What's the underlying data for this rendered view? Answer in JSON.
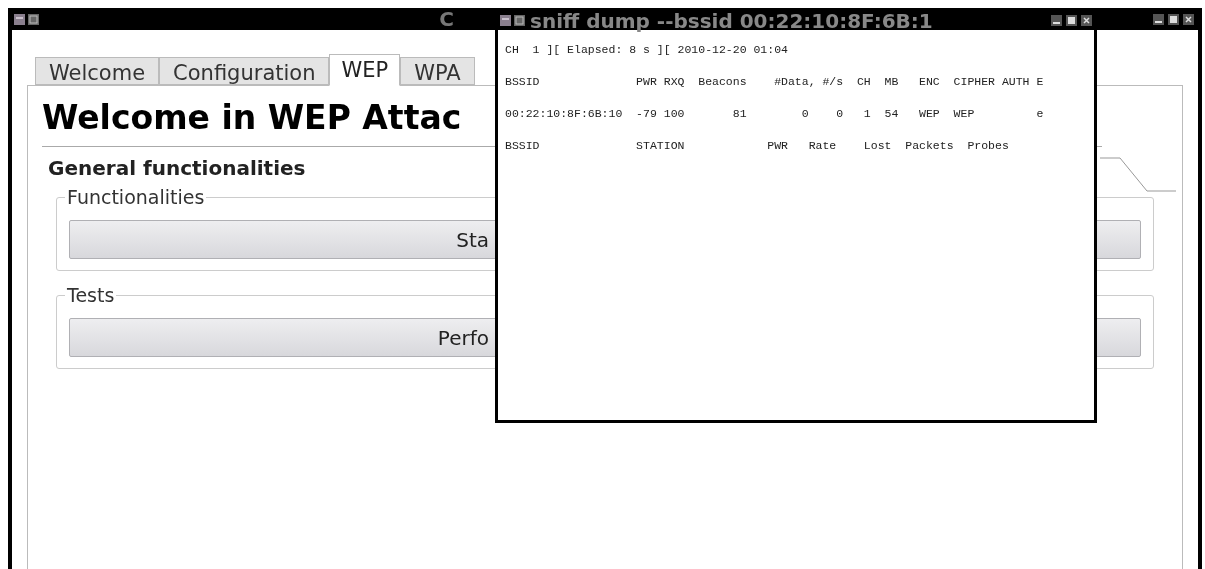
{
  "back_window": {
    "title": "C",
    "tabs": [
      {
        "label": "Welcome",
        "selected": false
      },
      {
        "label": "Configuration",
        "selected": false
      },
      {
        "label": "WEP",
        "selected": true
      },
      {
        "label": "WPA",
        "selected": false
      }
    ],
    "heading": "Welcome in WEP Attac",
    "section": "General functionalities",
    "groups": [
      {
        "title": "Functionalities",
        "button": "Sta"
      },
      {
        "title": "Tests",
        "button": "Perfo"
      }
    ]
  },
  "terminal_window": {
    "title": "sniff dump --bssid 00:22:10:8F:6B:1",
    "lines": [
      "CH  1 ][ Elapsed: 8 s ][ 2010-12-20 01:04",
      "BSSID              PWR RXQ  Beacons    #Data, #/s  CH  MB   ENC  CIPHER AUTH E",
      "00:22:10:8F:6B:10  -79 100       81        0    0   1  54   WEP  WEP         e",
      "BSSID              STATION            PWR   Rate    Lost  Packets  Probes"
    ]
  }
}
